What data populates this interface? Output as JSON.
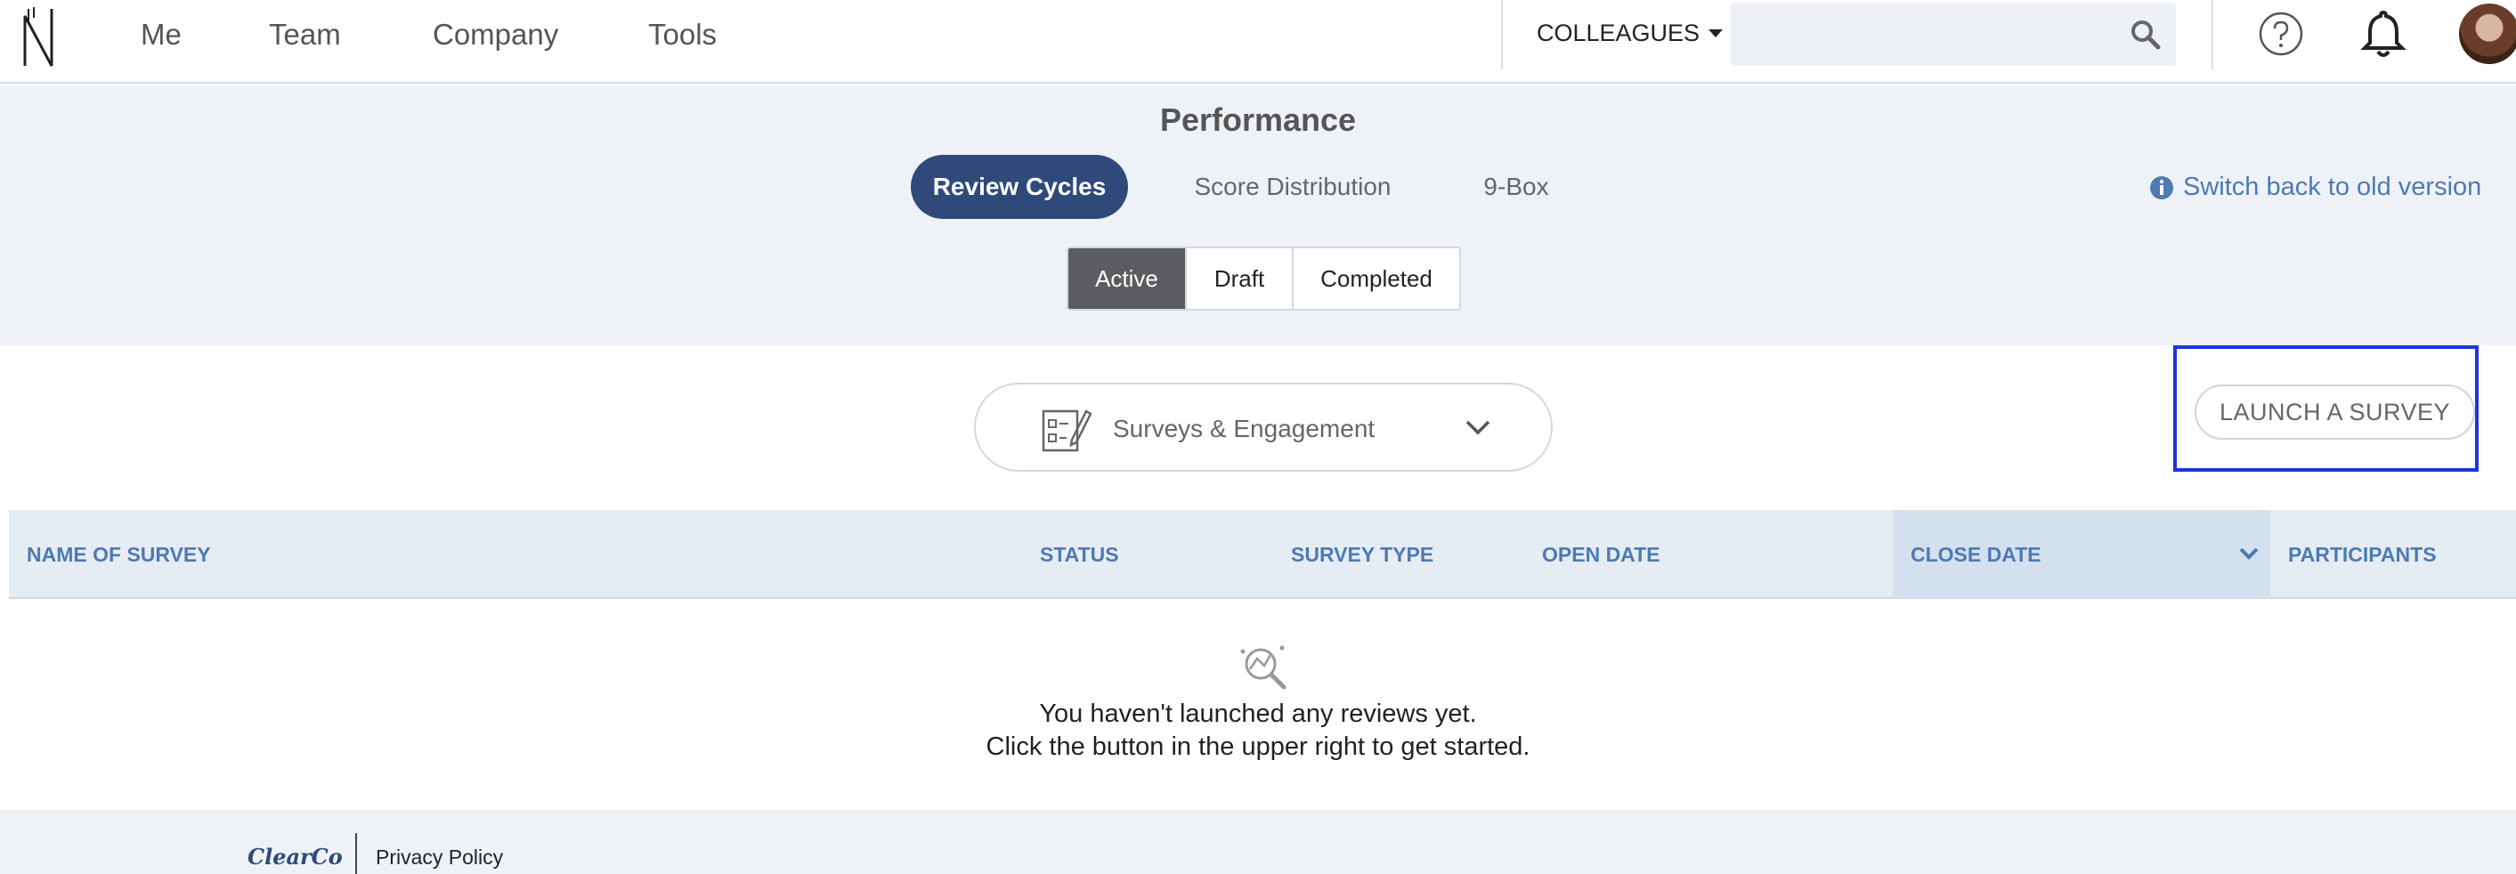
{
  "nav": {
    "links": [
      {
        "label": "Me"
      },
      {
        "label": "Team"
      },
      {
        "label": "Company"
      },
      {
        "label": "Tools"
      }
    ],
    "colleagues_label": "COLLEAGUES",
    "search_value": "",
    "icons": {
      "search": "search-icon",
      "help": "help-icon",
      "notifications": "bell-icon",
      "avatar": "avatar"
    }
  },
  "header": {
    "title": "Performance",
    "tabs": [
      {
        "label": "Review Cycles",
        "active": true
      },
      {
        "label": "Score Distribution",
        "active": false
      },
      {
        "label": "9-Box",
        "active": false
      }
    ],
    "switch_link": "Switch back to old version",
    "segments": [
      {
        "label": "Active",
        "active": true
      },
      {
        "label": "Draft",
        "active": false
      },
      {
        "label": "Completed",
        "active": false
      }
    ]
  },
  "filter": {
    "selected": "Surveys & Engagement",
    "launch_button": "LAUNCH A SURVEY"
  },
  "table": {
    "columns": [
      {
        "label": "NAME OF SURVEY"
      },
      {
        "label": "STATUS"
      },
      {
        "label": "SURVEY TYPE"
      },
      {
        "label": "OPEN DATE"
      },
      {
        "label": "CLOSE DATE",
        "sorted": true
      },
      {
        "label": "PARTICIPANTS"
      }
    ],
    "rows": [],
    "empty_line_1": "You haven't launched any reviews yet.",
    "empty_line_2": "Click the button in the upper right to get started."
  },
  "footer": {
    "brand": "ClearCo",
    "privacy": "Privacy Policy"
  },
  "colors": {
    "accent": "#2f4a7a",
    "link": "#4d7ab3",
    "highlight_frame": "#1a35e0"
  }
}
